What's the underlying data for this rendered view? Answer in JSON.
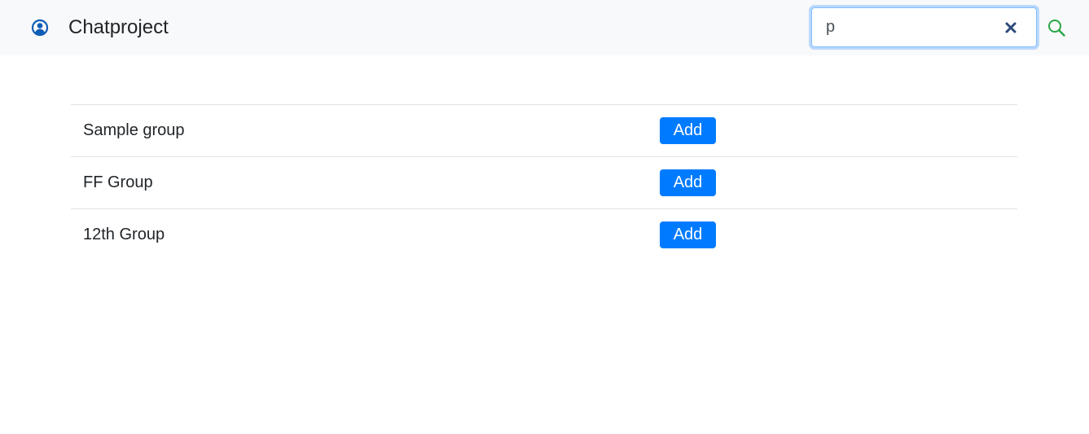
{
  "navbar": {
    "brand_icon": "user-circle-icon",
    "title": "Chatproject",
    "search": {
      "value": "p",
      "clear_icon": "close-icon",
      "search_icon": "search-icon"
    }
  },
  "groups": [
    {
      "name": "Sample group",
      "button_label": "Add"
    },
    {
      "name": "FF Group",
      "button_label": "Add"
    },
    {
      "name": "12th Group",
      "button_label": "Add"
    }
  ],
  "colors": {
    "navbar_bg": "#f8f9fa",
    "primary": "#007bff",
    "search_icon": "#28a745",
    "clear_icon": "#2c4a78",
    "brand_icon": "#0d5cb6"
  }
}
